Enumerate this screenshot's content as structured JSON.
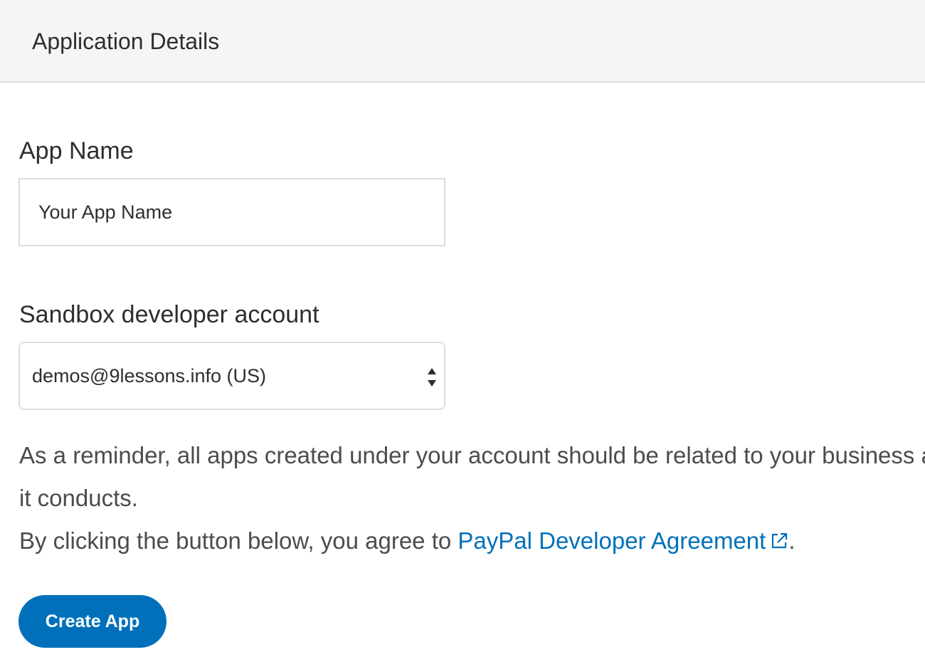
{
  "header": {
    "title": "Application Details"
  },
  "form": {
    "app_name": {
      "label": "App Name",
      "placeholder": "Your App Name"
    },
    "sandbox_account": {
      "label": "Sandbox developer account",
      "selected": "demos@9lessons.info (US)"
    },
    "reminder": {
      "line1": "As a reminder, all apps created under your account should be related to your business a",
      "line2": "it conducts."
    },
    "agreement": {
      "prefix": "By clicking the button below, you agree to ",
      "link_label": "PayPal Developer Agreement",
      "suffix": "."
    },
    "submit_label": "Create App"
  },
  "icons": {
    "external_link": "external-link-icon",
    "select_arrows": "select-arrows-icon"
  },
  "colors": {
    "accent": "#0070ba",
    "header_bg": "#f5f5f5",
    "text": "#2c2e2f"
  }
}
